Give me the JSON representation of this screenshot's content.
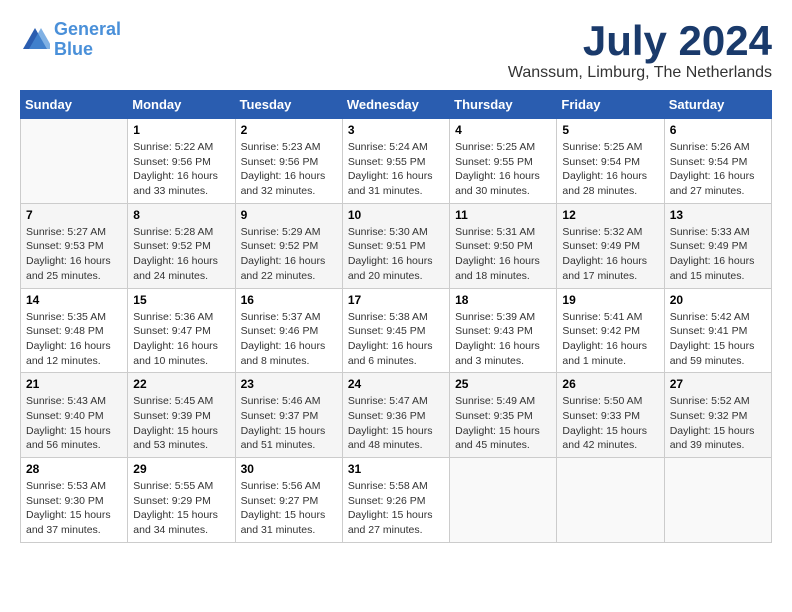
{
  "logo": {
    "line1": "General",
    "line2": "Blue"
  },
  "title": "July 2024",
  "location": "Wanssum, Limburg, The Netherlands",
  "weekdays": [
    "Sunday",
    "Monday",
    "Tuesday",
    "Wednesday",
    "Thursday",
    "Friday",
    "Saturday"
  ],
  "weeks": [
    [
      {
        "day": "",
        "info": ""
      },
      {
        "day": "1",
        "info": "Sunrise: 5:22 AM\nSunset: 9:56 PM\nDaylight: 16 hours\nand 33 minutes."
      },
      {
        "day": "2",
        "info": "Sunrise: 5:23 AM\nSunset: 9:56 PM\nDaylight: 16 hours\nand 32 minutes."
      },
      {
        "day": "3",
        "info": "Sunrise: 5:24 AM\nSunset: 9:55 PM\nDaylight: 16 hours\nand 31 minutes."
      },
      {
        "day": "4",
        "info": "Sunrise: 5:25 AM\nSunset: 9:55 PM\nDaylight: 16 hours\nand 30 minutes."
      },
      {
        "day": "5",
        "info": "Sunrise: 5:25 AM\nSunset: 9:54 PM\nDaylight: 16 hours\nand 28 minutes."
      },
      {
        "day": "6",
        "info": "Sunrise: 5:26 AM\nSunset: 9:54 PM\nDaylight: 16 hours\nand 27 minutes."
      }
    ],
    [
      {
        "day": "7",
        "info": "Sunrise: 5:27 AM\nSunset: 9:53 PM\nDaylight: 16 hours\nand 25 minutes."
      },
      {
        "day": "8",
        "info": "Sunrise: 5:28 AM\nSunset: 9:52 PM\nDaylight: 16 hours\nand 24 minutes."
      },
      {
        "day": "9",
        "info": "Sunrise: 5:29 AM\nSunset: 9:52 PM\nDaylight: 16 hours\nand 22 minutes."
      },
      {
        "day": "10",
        "info": "Sunrise: 5:30 AM\nSunset: 9:51 PM\nDaylight: 16 hours\nand 20 minutes."
      },
      {
        "day": "11",
        "info": "Sunrise: 5:31 AM\nSunset: 9:50 PM\nDaylight: 16 hours\nand 18 minutes."
      },
      {
        "day": "12",
        "info": "Sunrise: 5:32 AM\nSunset: 9:49 PM\nDaylight: 16 hours\nand 17 minutes."
      },
      {
        "day": "13",
        "info": "Sunrise: 5:33 AM\nSunset: 9:49 PM\nDaylight: 16 hours\nand 15 minutes."
      }
    ],
    [
      {
        "day": "14",
        "info": "Sunrise: 5:35 AM\nSunset: 9:48 PM\nDaylight: 16 hours\nand 12 minutes."
      },
      {
        "day": "15",
        "info": "Sunrise: 5:36 AM\nSunset: 9:47 PM\nDaylight: 16 hours\nand 10 minutes."
      },
      {
        "day": "16",
        "info": "Sunrise: 5:37 AM\nSunset: 9:46 PM\nDaylight: 16 hours\nand 8 minutes."
      },
      {
        "day": "17",
        "info": "Sunrise: 5:38 AM\nSunset: 9:45 PM\nDaylight: 16 hours\nand 6 minutes."
      },
      {
        "day": "18",
        "info": "Sunrise: 5:39 AM\nSunset: 9:43 PM\nDaylight: 16 hours\nand 3 minutes."
      },
      {
        "day": "19",
        "info": "Sunrise: 5:41 AM\nSunset: 9:42 PM\nDaylight: 16 hours\nand 1 minute."
      },
      {
        "day": "20",
        "info": "Sunrise: 5:42 AM\nSunset: 9:41 PM\nDaylight: 15 hours\nand 59 minutes."
      }
    ],
    [
      {
        "day": "21",
        "info": "Sunrise: 5:43 AM\nSunset: 9:40 PM\nDaylight: 15 hours\nand 56 minutes."
      },
      {
        "day": "22",
        "info": "Sunrise: 5:45 AM\nSunset: 9:39 PM\nDaylight: 15 hours\nand 53 minutes."
      },
      {
        "day": "23",
        "info": "Sunrise: 5:46 AM\nSunset: 9:37 PM\nDaylight: 15 hours\nand 51 minutes."
      },
      {
        "day": "24",
        "info": "Sunrise: 5:47 AM\nSunset: 9:36 PM\nDaylight: 15 hours\nand 48 minutes."
      },
      {
        "day": "25",
        "info": "Sunrise: 5:49 AM\nSunset: 9:35 PM\nDaylight: 15 hours\nand 45 minutes."
      },
      {
        "day": "26",
        "info": "Sunrise: 5:50 AM\nSunset: 9:33 PM\nDaylight: 15 hours\nand 42 minutes."
      },
      {
        "day": "27",
        "info": "Sunrise: 5:52 AM\nSunset: 9:32 PM\nDaylight: 15 hours\nand 39 minutes."
      }
    ],
    [
      {
        "day": "28",
        "info": "Sunrise: 5:53 AM\nSunset: 9:30 PM\nDaylight: 15 hours\nand 37 minutes."
      },
      {
        "day": "29",
        "info": "Sunrise: 5:55 AM\nSunset: 9:29 PM\nDaylight: 15 hours\nand 34 minutes."
      },
      {
        "day": "30",
        "info": "Sunrise: 5:56 AM\nSunset: 9:27 PM\nDaylight: 15 hours\nand 31 minutes."
      },
      {
        "day": "31",
        "info": "Sunrise: 5:58 AM\nSunset: 9:26 PM\nDaylight: 15 hours\nand 27 minutes."
      },
      {
        "day": "",
        "info": ""
      },
      {
        "day": "",
        "info": ""
      },
      {
        "day": "",
        "info": ""
      }
    ]
  ]
}
